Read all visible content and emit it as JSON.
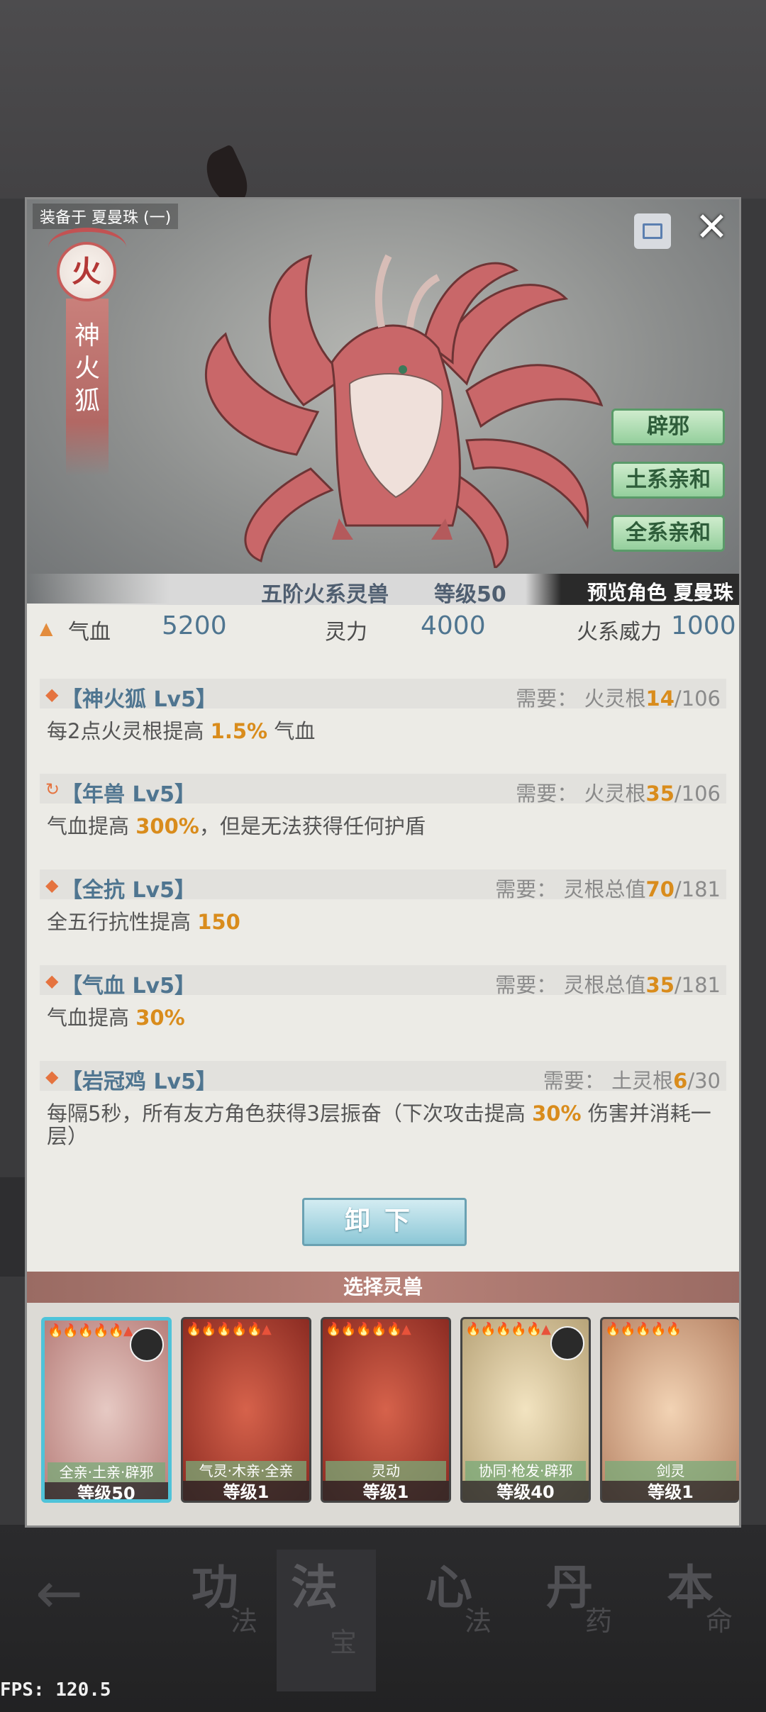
{
  "equip_label": "装备于 夏曼珠 (一)",
  "element": "火",
  "beast_name": "神火狐",
  "traits": [
    "辟邪",
    "土系亲和",
    "全系亲和"
  ],
  "tier": "五阶火系灵兽",
  "level": "等级50",
  "preview": "预览角色 夏曼珠",
  "stats": [
    {
      "label": "气血",
      "value": "5200"
    },
    {
      "label": "灵力",
      "value": "4000"
    },
    {
      "label": "火系威力",
      "value": "1000"
    }
  ],
  "skills": [
    {
      "icon": "◆",
      "name": "【神火狐 Lv5】",
      "req_label": "需要：",
      "req_type": "火灵根",
      "req_cur": "14",
      "req_max": "/106",
      "desc_pre": "每2点火灵根提高 ",
      "desc_hl": "1.5%",
      "desc_post": " 气血"
    },
    {
      "icon": "↻",
      "name": "【年兽 Lv5】",
      "req_label": "需要：",
      "req_type": "火灵根",
      "req_cur": "35",
      "req_max": "/106",
      "desc_pre": "气血提高 ",
      "desc_hl": "300%",
      "desc_post": "，但是无法获得任何护盾"
    },
    {
      "icon": "◆",
      "name": "【全抗 Lv5】",
      "req_label": "需要：",
      "req_type": "灵根总值",
      "req_cur": "70",
      "req_max": "/181",
      "desc_pre": "全五行抗性提高 ",
      "desc_hl": "150",
      "desc_post": ""
    },
    {
      "icon": "◆",
      "name": "【气血 Lv5】",
      "req_label": "需要：",
      "req_type": "灵根总值",
      "req_cur": "35",
      "req_max": "/181",
      "desc_pre": "气血提高 ",
      "desc_hl": "30%",
      "desc_post": ""
    },
    {
      "icon": "◆",
      "name": "【岩冠鸡 Lv5】",
      "req_label": "需要：",
      "req_type": "土灵根",
      "req_cur": "6",
      "req_max": "/30",
      "desc_pre": "每隔5秒，所有友方角色获得3层振奋（下次攻击提高 ",
      "desc_hl": "30%",
      "desc_post": " 伤害并消耗一层）"
    }
  ],
  "unequip_label": "卸下",
  "select_title": "选择灵兽",
  "cards": [
    {
      "traits": "全亲·土亲·辟邪",
      "level": "等级50",
      "stars": "🔥🔥🔥🔥🔥▲"
    },
    {
      "traits": "气灵·木亲·全亲",
      "level": "等级1",
      "stars": "🔥🔥🔥🔥🔥▲"
    },
    {
      "traits": "灵动",
      "level": "等级1",
      "stars": "🔥🔥🔥🔥🔥▲"
    },
    {
      "traits": "协同·枪发·辟邪",
      "level": "等级40",
      "stars": "🔥🔥🔥🔥🔥▲"
    },
    {
      "traits": "剑灵",
      "level": "等级1",
      "stars": "🔥🔥🔥🔥🔥"
    }
  ],
  "nav": [
    {
      "big": "功",
      "small": "法"
    },
    {
      "big": "法",
      "small": "宝"
    },
    {
      "big": "心",
      "small": "法"
    },
    {
      "big": "丹",
      "small": "药"
    },
    {
      "big": "本",
      "small": "命"
    }
  ],
  "fps": "FPS: 120.5",
  "colors": {
    "accent_blue": "#4f7590",
    "highlight_orange": "#d98c1c",
    "fox_red": "#c65c5a",
    "trait_green": "#94cf9c"
  }
}
